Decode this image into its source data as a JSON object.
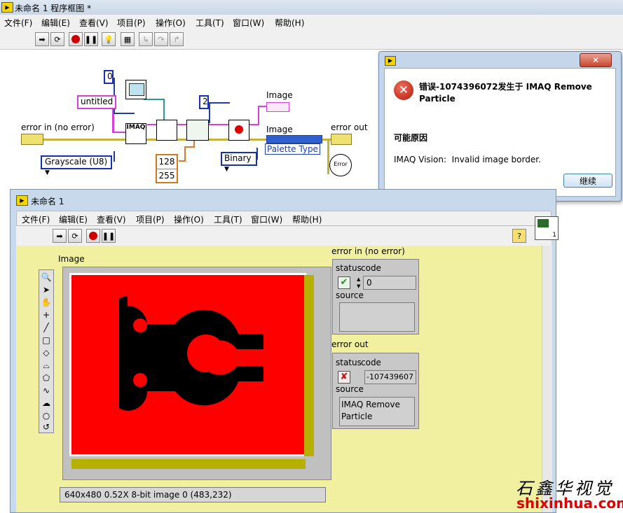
{
  "window_title": "未命名 1 程序框图 *",
  "menu": [
    "文件(F)",
    "编辑(E)",
    "查看(V)",
    "项目(P)",
    "操作(O)",
    "工具(T)",
    "窗口(W)",
    "帮助(H)"
  ],
  "block_diagram": {
    "error_in_label": "error in (no error)",
    "error_out_label": "error out",
    "image_label_top": "Image",
    "image_label_mid": "Image",
    "untitled_const": "untitled",
    "zero_const": "0",
    "two_const": "2",
    "const_128": "128",
    "const_255": "255",
    "grayscale_enum": "Grayscale (U8)",
    "binary_enum": "Binary",
    "palette_type": "Palette Type",
    "imaq_label": "IMAQ",
    "error_badge": "Error"
  },
  "dialog": {
    "heading": "错误-1074396072发生于 IMAQ Remove Particle",
    "cause_title": "可能原因",
    "cause_text": "IMAQ Vision:  Invalid image border.",
    "continue_button": "继续",
    "close_glyph": "✕"
  },
  "front_panel": {
    "title": "未命名 1",
    "menu": [
      "文件(F)",
      "编辑(E)",
      "查看(V)",
      "项目(P)",
      "操作(O)",
      "工具(T)",
      "窗口(W)",
      "帮助(H)"
    ],
    "image_label": "Image",
    "image_status": "640x480 0.52X 8-bit image 0     (483,232)",
    "error_in": {
      "label": "error in (no error)",
      "status_label": "status",
      "code_label": "code",
      "code_value": "0",
      "source_label": "source",
      "source_value": ""
    },
    "error_out": {
      "label": "error out",
      "status_label": "status",
      "code_label": "code",
      "code_value": "-107439607",
      "source_label": "source",
      "source_value": "IMAQ Remove Particle"
    },
    "help_glyph": "?",
    "vi_icon_number": "1"
  },
  "watermark": {
    "chinese": "石鑫华视觉",
    "url": "shixinhua.com"
  },
  "colors": {
    "image_bg": "#ff0000",
    "particle": "#000000",
    "panel_bg": "#f0f0a0",
    "wire_error": "#c4b23a",
    "wire_image": "#d640d6"
  }
}
